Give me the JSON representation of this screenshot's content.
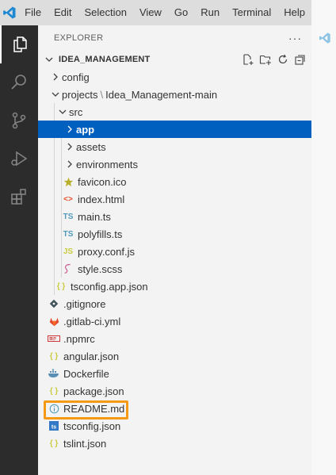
{
  "menu": [
    "File",
    "Edit",
    "Selection",
    "View",
    "Go",
    "Run",
    "Terminal",
    "Help"
  ],
  "explorer": {
    "title": "EXPLORER",
    "more": "···",
    "root": "IDEA_MANAGEMENT"
  },
  "tree": {
    "config": "config",
    "projects": "projects",
    "projects_sub": "Idea_Management-main",
    "src": "src",
    "app": "app",
    "assets": "assets",
    "environments": "environments",
    "favicon": "favicon.ico",
    "index": "index.html",
    "main": "main.ts",
    "polyfills": "polyfills.ts",
    "proxy": "proxy.conf.js",
    "style": "style.scss",
    "tsconfig_app": "tsconfig.app.json",
    "gitignore": ".gitignore",
    "gitlab": ".gitlab-ci.yml",
    "npmrc": ".npmrc",
    "angular": "angular.json",
    "dockerfile": "Dockerfile",
    "package": "package.json",
    "readme": "README.md",
    "tsconfig": "tsconfig.json",
    "tslint": "tslint.json"
  },
  "icons": {
    "ts": "TS",
    "js": "JS",
    "json": "{ }",
    "html": "<>"
  },
  "colors": {
    "selection": "#0060c0",
    "highlight": "#f59a12",
    "json": "#cbcb41",
    "ts": "#519aba",
    "js": "#cbcb41",
    "html": "#e44d26",
    "activitybar": "#2c2c2c"
  }
}
